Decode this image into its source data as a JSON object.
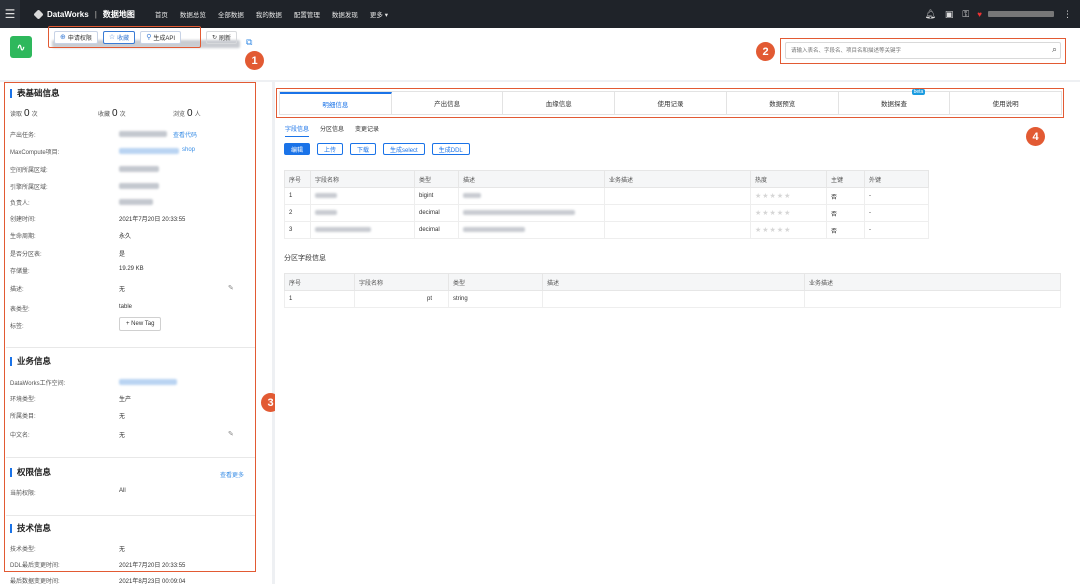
{
  "topbar": {
    "brand": "DataWorks",
    "module": "数据地图",
    "nav": [
      "首页",
      "数据总览",
      "全部数据",
      "我的数据",
      "配置管理",
      "数据发现",
      "更多 ▾"
    ]
  },
  "header": {
    "actions": [
      "申请权限",
      "收藏",
      "生成API"
    ],
    "refresh": "刷新"
  },
  "search": {
    "placeholder": "请输入表名、字段名、项目名和描述等关键字"
  },
  "badges": [
    "1",
    "2",
    "3",
    "4"
  ],
  "basic": {
    "title": "表基础信息",
    "read_label": "读取",
    "read_val": "0",
    "read_unit": "次",
    "fav_label": "收藏",
    "fav_val": "0",
    "fav_unit": "次",
    "view_label": "浏览",
    "view_val": "0",
    "view_unit": "人",
    "rows": [
      {
        "k": "产出任务:",
        "v": "",
        "link": "查看代码"
      },
      {
        "k": "MaxCompute项目:",
        "v": "",
        "link": "shop"
      },
      {
        "k": "空间所属区域:",
        "v": ""
      },
      {
        "k": "引擎所属区域:",
        "v": ""
      },
      {
        "k": "负责人:",
        "v": ""
      },
      {
        "k": "创建时间:",
        "v": "2021年7月20日 20:33:55"
      },
      {
        "k": "生命周期:",
        "v": "永久"
      },
      {
        "k": "是否分区表:",
        "v": "是"
      },
      {
        "k": "存储量:",
        "v": "19.29 KB"
      },
      {
        "k": "描述:",
        "v": "无"
      },
      {
        "k": "表类型:",
        "v": "table"
      },
      {
        "k": "标签:",
        "v": ""
      }
    ],
    "new_tag": "+ New Tag"
  },
  "business": {
    "title": "业务信息",
    "rows": [
      {
        "k": "DataWorks工作空间:",
        "v": ""
      },
      {
        "k": "环境类型:",
        "v": "生产"
      },
      {
        "k": "所属类目:",
        "v": "无"
      },
      {
        "k": "中文名:",
        "v": "无"
      }
    ]
  },
  "permission": {
    "title": "权限信息",
    "more": "查看更多",
    "rows": [
      {
        "k": "当前权限:",
        "v": "All"
      }
    ]
  },
  "tech": {
    "title": "技术信息",
    "rows": [
      {
        "k": "技术类型:",
        "v": "无"
      },
      {
        "k": "DDL最后变更时间:",
        "v": "2021年7月20日 20:33:55"
      },
      {
        "k": "最后数据变更时间:",
        "v": "2021年8月23日 00:09:04"
      }
    ]
  },
  "tabs": [
    "明细信息",
    "产出信息",
    "血缘信息",
    "使用记录",
    "数据预览",
    "数据探查",
    "使用说明"
  ],
  "beta": "beta",
  "subtabs": [
    "字段信息",
    "分区信息",
    "变更记录"
  ],
  "toolbar": [
    "编辑",
    "上传",
    "下载",
    "生成select",
    "生成DDL"
  ],
  "fields_table": {
    "headers": [
      "序号",
      "字段名称",
      "类型",
      "描述",
      "业务描述",
      "热度",
      "主键",
      "外键"
    ],
    "rows": [
      {
        "no": "1",
        "type": "bigint",
        "pk": "否",
        "fk": "-"
      },
      {
        "no": "2",
        "type": "decimal",
        "pk": "否",
        "fk": "-"
      },
      {
        "no": "3",
        "type": "decimal",
        "pk": "否",
        "fk": "-"
      }
    ],
    "stars": "★★★★★"
  },
  "partition": {
    "title": "分区字段信息",
    "headers": [
      "序号",
      "字段名称",
      "类型",
      "描述",
      "业务描述"
    ],
    "rows": [
      {
        "no": "1",
        "name": "pt",
        "type": "string"
      }
    ]
  }
}
